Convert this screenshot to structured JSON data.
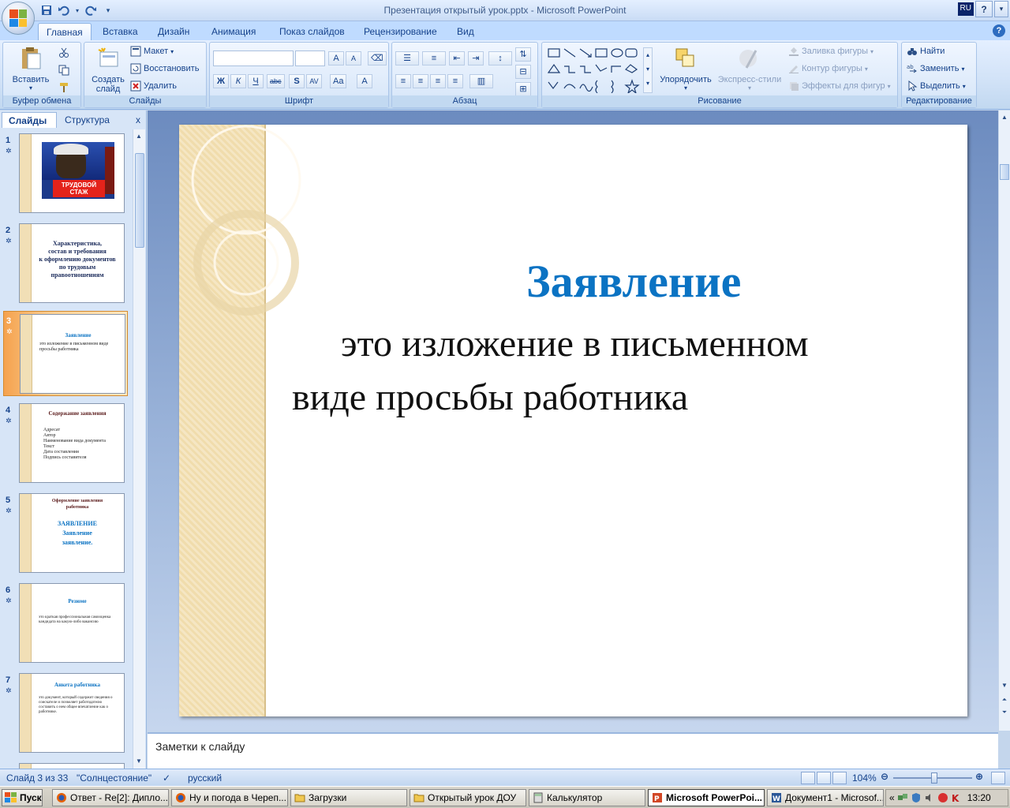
{
  "window": {
    "title": "Презентация открытый урок.pptx - Microsoft PowerPoint",
    "lang_indicator": "RU"
  },
  "qat": {
    "icons": [
      "save-icon",
      "undo-icon",
      "redo-icon",
      "customize-icon"
    ]
  },
  "ribbon": {
    "tabs": [
      "Главная",
      "Вставка",
      "Дизайн",
      "Анимация",
      "Показ слайдов",
      "Рецензирование",
      "Вид"
    ],
    "active_tab": "Главная",
    "clipboard": {
      "label": "Буфер обмена",
      "paste": "Вставить"
    },
    "slides": {
      "label": "Слайды",
      "new_slide_line1": "Создать",
      "new_slide_line2": "слайд",
      "layout": "Макет",
      "reset": "Восстановить",
      "delete": "Удалить"
    },
    "font": {
      "label": "Шрифт",
      "bold": "Ж",
      "italic": "К",
      "underline": "Ч",
      "strike": "abc",
      "shadow": "S",
      "spacing": "AV",
      "case": "Aa",
      "color": "A",
      "grow": "A",
      "shrink": "A"
    },
    "paragraph": {
      "label": "Абзац"
    },
    "drawing": {
      "label": "Рисование",
      "arrange": "Упорядочить",
      "quick_styles": "Экспресс-стили",
      "shape_fill": "Заливка фигуры",
      "shape_outline": "Контур фигуры",
      "shape_effects": "Эффекты для фигур"
    },
    "editing": {
      "label": "Редактирование",
      "find": "Найти",
      "replace": "Заменить",
      "select": "Выделить"
    }
  },
  "left_pane": {
    "tab_slides": "Слайды",
    "tab_outline": "Структура",
    "close": "x",
    "thumbnails": [
      {
        "num": "1",
        "title_lines": [
          "ТРУДОВОЙ",
          "СТАЖ"
        ]
      },
      {
        "num": "2",
        "title_lines": [
          "Характеристика,",
          "состав и требования",
          "к оформлению документов",
          "по трудовым",
          "правоотношениям"
        ]
      },
      {
        "num": "3",
        "title": "Заявление",
        "body": "это изложение в письменном виде просьбы работника"
      },
      {
        "num": "4",
        "title": "Содержание заявления",
        "items": [
          "Адресат",
          "Автор",
          "Наименование вида документа",
          "Текст",
          "Дата составления",
          "Подпись составителя"
        ]
      },
      {
        "num": "5",
        "title_lines": [
          "Оформление заявления",
          "работника"
        ],
        "body_lines": [
          "ЗАЯВЛЕНИЕ",
          "Заявление",
          "заявление."
        ]
      },
      {
        "num": "6",
        "title": "Резюме",
        "body": "это краткая профессиональная самооценка кандидата на какую-либо вакансию"
      },
      {
        "num": "7",
        "title": "Анкета работника",
        "body": "это документ, который содержит сведения о соискателе и позволяет работодателю составить о нем общее впечатление как о работнике."
      }
    ]
  },
  "slide": {
    "title": "Заявление",
    "line1": "это изложение в письменном",
    "line2": "виде просьбы работника"
  },
  "notes": {
    "placeholder": "Заметки к слайду"
  },
  "status": {
    "slide_info": "Слайд 3 из 33",
    "theme": "\"Солнцестояние\"",
    "language": "русский",
    "zoom": "104%"
  },
  "taskbar": {
    "start": "Пуск",
    "items": [
      {
        "label": "Ответ - Re[2]: Дипло...",
        "icon": "firefox-icon"
      },
      {
        "label": "Ну и погода в Череп...",
        "icon": "firefox-icon"
      },
      {
        "label": "Загрузки",
        "icon": "folder-icon"
      },
      {
        "label": "Открытый урок ДОУ",
        "icon": "folder-icon"
      },
      {
        "label": "Калькулятор",
        "icon": "calculator-icon"
      },
      {
        "label": "Microsoft PowerPoi...",
        "icon": "powerpoint-icon",
        "active": true
      },
      {
        "label": "Документ1 - Microsof...",
        "icon": "word-icon"
      }
    ],
    "clock": "13:20"
  },
  "colors": {
    "slide_title": "#0b73c3",
    "ribbon_bg": "#d1e2f7",
    "selected_thumb": "#f5a24e"
  }
}
